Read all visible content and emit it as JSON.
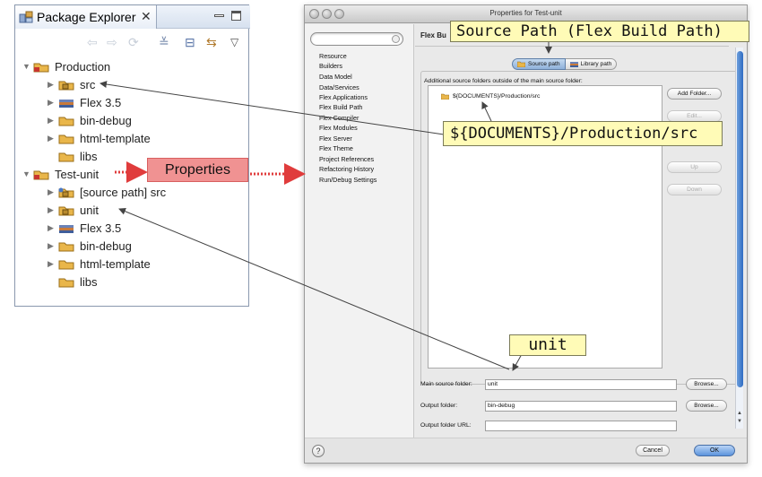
{
  "package_explorer": {
    "title": "Package Explorer",
    "close_glyph": "✕",
    "toolbar": [
      "⇦",
      "⇨",
      "⟳",
      "≚",
      "⊟",
      "⇆",
      "▽"
    ],
    "tree": [
      {
        "label": "Production",
        "expanded": true,
        "icon": "project-icon"
      },
      {
        "label": "src",
        "icon": "source-folder-icon"
      },
      {
        "label": "Flex 3.5",
        "icon": "library-icon"
      },
      {
        "label": "bin-debug",
        "icon": "folder-icon"
      },
      {
        "label": "html-template",
        "icon": "folder-icon"
      },
      {
        "label": "libs",
        "icon": "folder-icon"
      },
      {
        "label": "Test-unit",
        "expanded": true,
        "icon": "project-icon"
      },
      {
        "label": "[source path] src",
        "icon": "linked-source-folder-icon"
      },
      {
        "label": "unit",
        "icon": "source-folder-icon"
      },
      {
        "label": "Flex 3.5",
        "icon": "library-icon"
      },
      {
        "label": "bin-debug",
        "icon": "folder-icon"
      },
      {
        "label": "html-template",
        "icon": "folder-icon"
      },
      {
        "label": "libs",
        "icon": "folder-icon"
      }
    ]
  },
  "dialog": {
    "title": "Properties for Test-unit",
    "nav_items": [
      "Resource",
      "Builders",
      "Data Model",
      "Data/Services",
      "Flex Applications",
      "Flex Build Path",
      "Flex Compiler",
      "Flex Modules",
      "Flex Server",
      "Flex Theme",
      "Project References",
      "Refactoring History",
      "Run/Debug Settings"
    ],
    "page_heading": "Flex Bu",
    "tabs": {
      "source_path": "Source path",
      "library_path": "Library path"
    },
    "group_label": "Additional source folders outside of the main source folder:",
    "source_folders": [
      "${DOCUMENTS}/Production/src"
    ],
    "side_buttons": {
      "add_folder": "Add Folder...",
      "edit": "Edit...",
      "up": "Up",
      "down": "Down"
    },
    "fields": {
      "main_source_label": "Main source folder:",
      "main_source_value": "unit",
      "output_folder_label": "Output folder:",
      "output_folder_value": "bin-debug",
      "output_url_label": "Output folder URL:",
      "output_url_value": "",
      "browse": "Browse..."
    },
    "help_glyph": "?",
    "cancel": "Cancel",
    "ok": "OK"
  },
  "callouts": {
    "source_path_title": "Source Path (Flex Build Path)",
    "documents_path": "${DOCUMENTS}/Production/src",
    "properties": "Properties",
    "unit": "unit"
  },
  "colors": {
    "callout_yellow": "#fffbb7",
    "callout_red": "#f09292",
    "arrow_red": "#e03c3c",
    "selection_blue": "#5b93dd"
  }
}
